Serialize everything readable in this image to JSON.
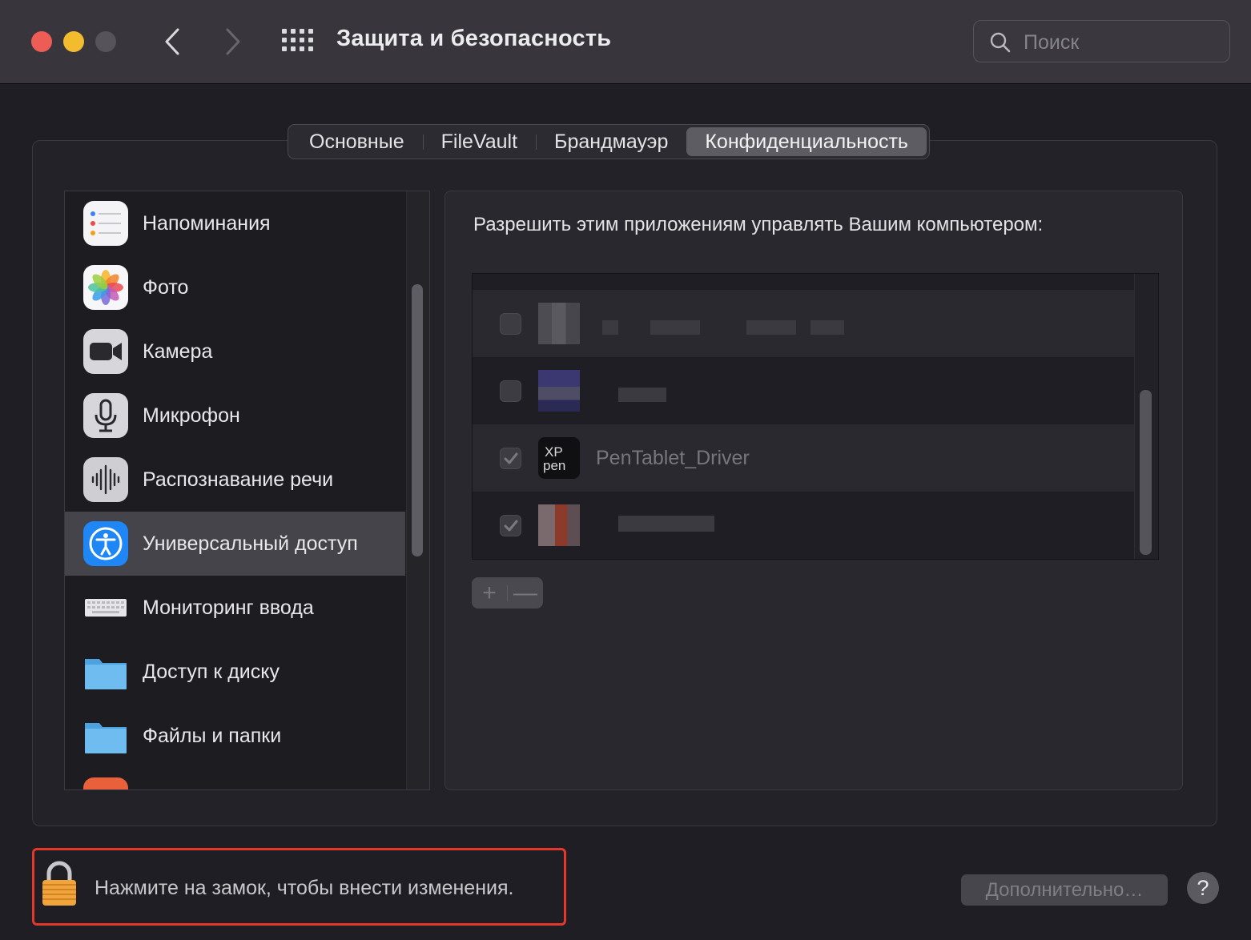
{
  "window": {
    "title": "Защита и безопасность"
  },
  "search": {
    "placeholder": "Поиск",
    "value": ""
  },
  "tabs": [
    {
      "label": "Основные",
      "active": false
    },
    {
      "label": "FileVault",
      "active": false
    },
    {
      "label": "Брандмауэр",
      "active": false
    },
    {
      "label": "Конфиденциальность",
      "active": true
    }
  ],
  "sidebar": {
    "items": [
      {
        "label": "Напоминания",
        "icon": "reminders-icon"
      },
      {
        "label": "Фото",
        "icon": "photos-icon"
      },
      {
        "label": "Камера",
        "icon": "camera-icon"
      },
      {
        "label": "Микрофон",
        "icon": "microphone-icon"
      },
      {
        "label": "Распознавание речи",
        "icon": "speech-recognition-icon"
      },
      {
        "label": "Универсальный доступ",
        "icon": "accessibility-icon",
        "selected": true
      },
      {
        "label": "Мониторинг ввода",
        "icon": "keyboard-icon"
      },
      {
        "label": "Доступ к диску",
        "icon": "folder-icon"
      },
      {
        "label": "Файлы и папки",
        "icon": "folder-icon"
      }
    ]
  },
  "right": {
    "heading": "Разрешить этим приложениям управлять Вашим компьютером:",
    "apps": [
      {
        "name": "",
        "checked": false,
        "blurred": true
      },
      {
        "name": "",
        "checked": false,
        "blurred": true
      },
      {
        "name": "PenTablet_Driver",
        "checked": true,
        "blurred": false
      },
      {
        "name": "",
        "checked": true,
        "blurred": true
      }
    ],
    "add_label": "+",
    "remove_label": "—"
  },
  "bottom": {
    "lock_text": "Нажмите на замок, чтобы внести изменения.",
    "advanced_label": "Дополнительно…",
    "help_label": "?"
  },
  "colors": {
    "highlight_border": "#e3382a",
    "selected_row": "#45444a",
    "accessibility_blue": "#1e86f5"
  }
}
